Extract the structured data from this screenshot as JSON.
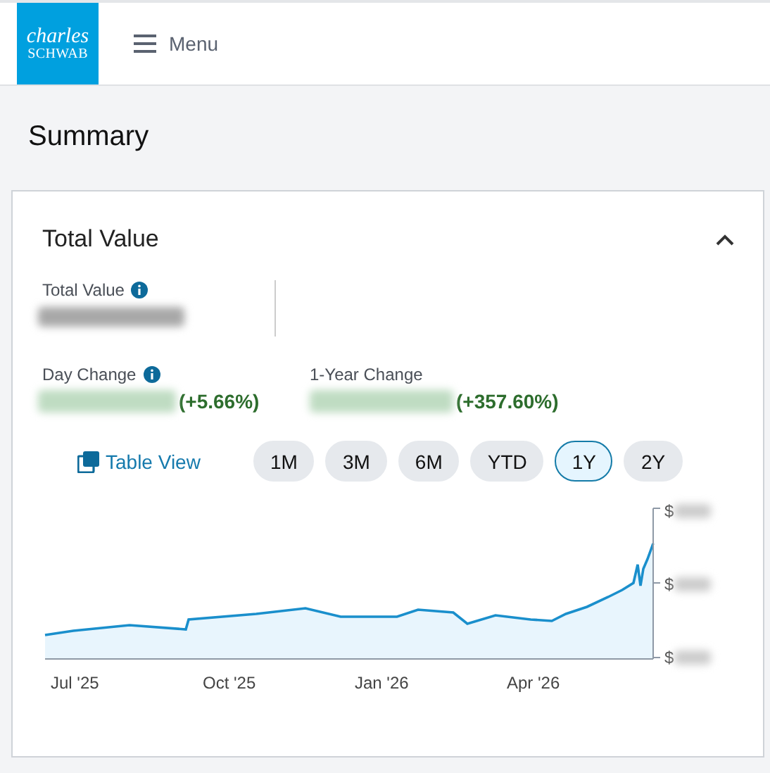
{
  "header": {
    "logo": {
      "line_1": "charles",
      "line_2": "SCHWAB"
    },
    "menu_label": "Menu"
  },
  "page_title": "Summary",
  "card": {
    "title": "Total Value",
    "expanded": true,
    "total_value": {
      "label": "Total Value"
    },
    "day_change": {
      "label": "Day Change",
      "percent": "(+5.66%)"
    },
    "year_change": {
      "label": "1-Year Change",
      "percent": "(+357.60%)"
    },
    "table_view": "Table View",
    "ranges": [
      {
        "label": "1M",
        "selected": false
      },
      {
        "label": "3M",
        "selected": false
      },
      {
        "label": "6M",
        "selected": false
      },
      {
        "label": "YTD",
        "selected": false
      },
      {
        "label": "1Y",
        "selected": true
      },
      {
        "label": "2Y",
        "selected": false
      }
    ],
    "chart": {
      "y_labels": [
        "$",
        "$",
        "$"
      ],
      "x_labels": [
        "Jul '25",
        "Oct '25",
        "Jan '26",
        "Apr '26"
      ]
    }
  }
}
